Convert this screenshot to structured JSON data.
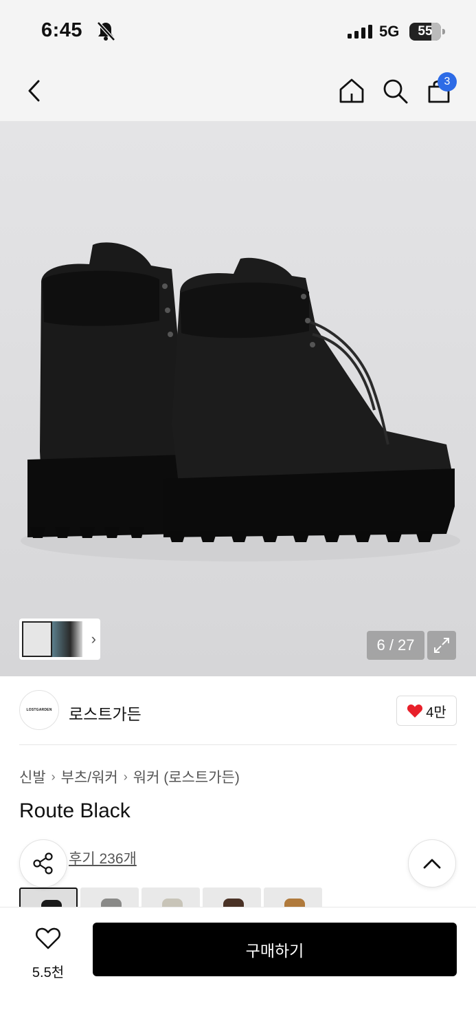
{
  "status_bar": {
    "time": "6:45",
    "network": "5G",
    "battery": "55"
  },
  "nav": {
    "cart_count": "3"
  },
  "gallery": {
    "counter": "6 / 27"
  },
  "brand": {
    "logo_text": "LOSTGARDEN",
    "name": "로스트가든",
    "likes": "4만"
  },
  "breadcrumb": [
    "신발",
    "부츠/워커",
    "워커 (로스트가든)"
  ],
  "product": {
    "title": "Route Black",
    "reviews": "후기 236개"
  },
  "bottom": {
    "wish_count": "5.5천",
    "buy_label": "구매하기"
  },
  "colors": {
    "accent_badge": "#2d6be6",
    "heart": "#e8202a",
    "buy_button": "#000000"
  }
}
